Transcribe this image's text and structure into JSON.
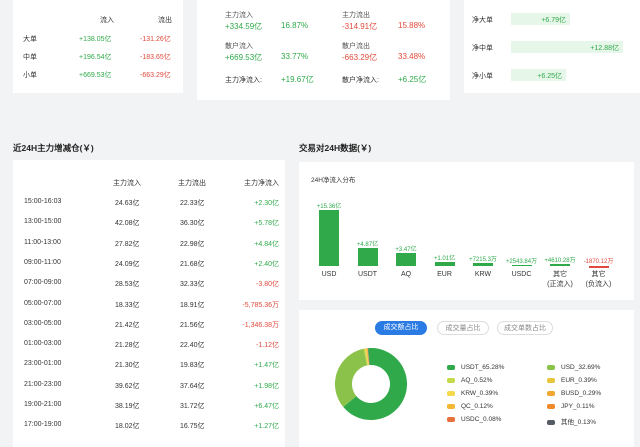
{
  "flow_table": {
    "headers": [
      "流入",
      "流出"
    ],
    "rows": [
      {
        "label": "大单",
        "in": "+138.05亿",
        "out": "-131.26亿"
      },
      {
        "label": "中单",
        "in": "+196.54亿",
        "out": "-183.65亿"
      },
      {
        "label": "小单",
        "in": "+669.53亿",
        "out": "-663.29亿"
      }
    ]
  },
  "summary": {
    "main_in_label": "主力流入",
    "main_in_val": "+334.59亿",
    "main_in_pct": "16.87%",
    "main_out_label": "主力流出",
    "main_out_val": "-314.91亿",
    "main_out_pct": "15.88%",
    "retail_in_label": "散户流入",
    "retail_in_val": "+669.53亿",
    "retail_in_pct": "33.77%",
    "retail_out_label": "散户流出",
    "retail_out_val": "-663.29亿",
    "retail_out_pct": "33.48%",
    "main_net_label": "主力净流入:",
    "main_net_val": "+19.67亿",
    "retail_net_label": "散户净流入:",
    "retail_net_val": "+6.25亿"
  },
  "net": {
    "rows": [
      {
        "label": "净大单",
        "value": "+6.79亿",
        "fraction": 0.53
      },
      {
        "label": "净中单",
        "value": "+12.88亿",
        "fraction": 1.0
      },
      {
        "label": "净小单",
        "value": "+6.25亿",
        "fraction": 0.49
      }
    ]
  },
  "history": {
    "title": "近24H主力增减仓(￥)",
    "headers": [
      "主力流入",
      "主力流出",
      "主力净流入"
    ],
    "rows": [
      {
        "time": "15:00-16:03",
        "in": "24.63亿",
        "out": "22.33亿",
        "net": "+2.30亿",
        "pos": true
      },
      {
        "time": "13:00-15:00",
        "in": "42.08亿",
        "out": "36.30亿",
        "net": "+5.78亿",
        "pos": true
      },
      {
        "time": "11:00-13:00",
        "in": "27.82亿",
        "out": "22.98亿",
        "net": "+4.84亿",
        "pos": true
      },
      {
        "time": "09:00-11:00",
        "in": "24.09亿",
        "out": "21.68亿",
        "net": "+2.40亿",
        "pos": true
      },
      {
        "time": "07:00-09:00",
        "in": "28.53亿",
        "out": "32.33亿",
        "net": "-3.80亿",
        "pos": false
      },
      {
        "time": "05:00-07:00",
        "in": "18.33亿",
        "out": "18.91亿",
        "net": "-5,785.36万",
        "pos": false
      },
      {
        "time": "03:00-05:00",
        "in": "21.42亿",
        "out": "21.56亿",
        "net": "-1,346.38万",
        "pos": false
      },
      {
        "time": "01:00-03:00",
        "in": "21.28亿",
        "out": "22.40亿",
        "net": "-1.12亿",
        "pos": false
      },
      {
        "time": "23:00-01:00",
        "in": "21.30亿",
        "out": "19.83亿",
        "net": "+1.47亿",
        "pos": true
      },
      {
        "time": "21:00-23:00",
        "in": "39.62亿",
        "out": "37.64亿",
        "net": "+1.98亿",
        "pos": true
      },
      {
        "time": "19:00-21:00",
        "in": "38.19亿",
        "out": "31.72亿",
        "net": "+6.47亿",
        "pos": true
      },
      {
        "time": "17:00-19:00",
        "in": "18.02亿",
        "out": "16.75亿",
        "net": "+1.27亿",
        "pos": true
      }
    ]
  },
  "pairs": {
    "title": "交易对24H数据(￥)",
    "subtitle": "24H净流入分布",
    "colors": {
      "pos": "#2fa94a",
      "neg": "#e04a3c"
    },
    "bars": [
      {
        "cat": "USD",
        "label": "+15.36亿",
        "value": 15.36
      },
      {
        "cat": "USDT",
        "label": "+4.87亿",
        "value": 4.87
      },
      {
        "cat": "AQ",
        "label": "+3.47亿",
        "value": 3.47
      },
      {
        "cat": "EUR",
        "label": "+1.01亿",
        "value": 1.01
      },
      {
        "cat": "KRW",
        "label": "+7215.3万",
        "value": 0.72153
      },
      {
        "cat": "USDC",
        "label": "+2543.84万",
        "value": 0.254384
      },
      {
        "cat": "其它\n(正流入)",
        "label": "+4610.28万",
        "value": 0.461028
      },
      {
        "cat": "其它\n(负流入)",
        "label": "-1870.12万",
        "value": -0.187012
      }
    ]
  },
  "share": {
    "tabs": [
      "成交额占比",
      "成交量占比",
      "成交单数占比"
    ],
    "active_tab": 0,
    "legend": [
      {
        "name": "USDT_65.28%",
        "pct": 65.28,
        "color": "#2fa94a"
      },
      {
        "name": "USD_32.69%",
        "pct": 32.69,
        "color": "#8bc34a"
      },
      {
        "name": "AQ_0.52%",
        "pct": 0.52,
        "color": "#c5d94a"
      },
      {
        "name": "EUR_0.39%",
        "pct": 0.39,
        "color": "#e8c53a"
      },
      {
        "name": "KRW_0.39%",
        "pct": 0.39,
        "color": "#f5d94a"
      },
      {
        "name": "BUSD_0.29%",
        "pct": 0.29,
        "color": "#f0a830"
      },
      {
        "name": "QC_0.12%",
        "pct": 0.12,
        "color": "#f5b732"
      },
      {
        "name": "JPY_0.11%",
        "pct": 0.11,
        "color": "#ef8a2c"
      },
      {
        "name": "USDC_0.08%",
        "pct": 0.08,
        "color": "#e8703a"
      },
      {
        "name": "其他_0.13%",
        "pct": 0.13,
        "color": "#555a66"
      }
    ]
  }
}
